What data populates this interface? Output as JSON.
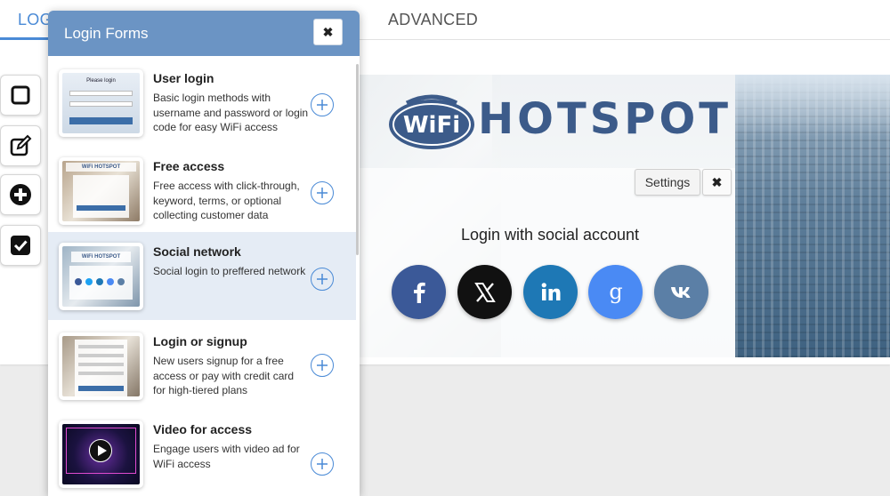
{
  "tabs": {
    "login": "LOGIN",
    "advanced": "ADVANCED"
  },
  "toolbar": {
    "tools": [
      {
        "icon": "square-icon"
      },
      {
        "icon": "edit-icon"
      },
      {
        "icon": "plus-circle-icon"
      },
      {
        "icon": "check-square-icon"
      }
    ]
  },
  "panel": {
    "title": "Login Forms",
    "close_label": "✖",
    "items": [
      {
        "title": "User login",
        "description": "Basic login methods with username and password or login code for easy WiFi access",
        "thumb_text": "Please login"
      },
      {
        "title": "Free access",
        "description": "Free access with click-through, keyword, terms, or optional collecting customer data",
        "thumb_text": "WiFi HOTSPOT"
      },
      {
        "title": "Social network",
        "description": "Social login to preffered network",
        "thumb_text": "WiFi HOTSPOT"
      },
      {
        "title": "Login or signup",
        "description": "New users signup for a free access or pay with credit card for high-tiered plans",
        "thumb_text": ""
      },
      {
        "title": "Video for access",
        "description": "Engage users with video ad for WiFi access",
        "thumb_text": ""
      }
    ]
  },
  "preview": {
    "logo_wifi": "WiFi",
    "logo_hotspot": "HOTSPOT",
    "settings_label": "Settings",
    "close_label": "✖",
    "social_title": "Login with social account",
    "social_buttons": [
      {
        "name": "facebook",
        "color": "#3b5998",
        "glyph": "f"
      },
      {
        "name": "x",
        "color": "#111111",
        "glyph": "𝕏"
      },
      {
        "name": "linkedin",
        "color": "#1e78b5",
        "glyph": "in"
      },
      {
        "name": "google",
        "color": "#4a8af4",
        "glyph": "g"
      },
      {
        "name": "vk",
        "color": "#5b7fa6",
        "glyph": "vk"
      }
    ]
  },
  "colors": {
    "accent": "#4a8ad6",
    "panel_header": "#6b94c4",
    "selected_row": "#e5ecf5"
  }
}
